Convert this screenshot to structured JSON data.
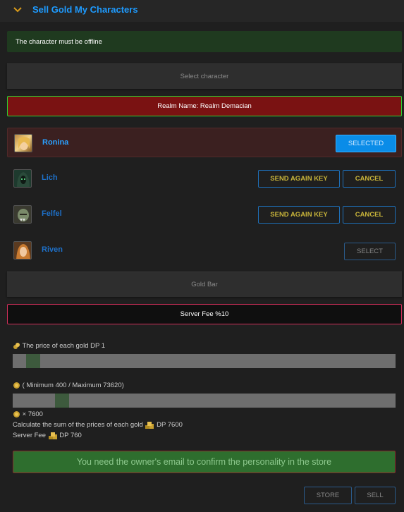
{
  "header": {
    "title": "Sell Gold My Characters"
  },
  "notice": "The character must be offline",
  "select_character_label": "Select character",
  "realm_label": "Realm Name: Realm Demacian",
  "characters": [
    {
      "name": "Ronina",
      "state": "selected",
      "selected_label": "SELECTED"
    },
    {
      "name": "Lich",
      "state": "pending",
      "send_label": "SEND AGAIN KEY",
      "cancel_label": "CANCEL"
    },
    {
      "name": "Felfel",
      "state": "pending",
      "send_label": "SEND AGAIN KEY",
      "cancel_label": "CANCEL"
    },
    {
      "name": "Riven",
      "state": "selectable",
      "select_label": "SELECT"
    }
  ],
  "gold_bar_label": "Gold Bar",
  "server_fee_label": "Server Fee %10",
  "price": {
    "label": "The price of each gold DP 1",
    "slider_fraction": 0.035
  },
  "amount": {
    "label": "( Minimum 400 / Maximum 73620)",
    "slider_fraction": 0.11
  },
  "summary": {
    "multiplier": "× 7600",
    "sum_label": "Calculate the sum of the prices of each gold",
    "sum_value": "DP 7600",
    "fee_label": "Server Fee",
    "fee_value": "DP 760"
  },
  "confirm_message": "You need the owner's email to confirm the personality in the store",
  "actions": {
    "store": "STORE",
    "sell": "SELL"
  },
  "colors": {
    "accent": "#1e9bff",
    "realm_bg": "#7a1212",
    "confirm_bg": "#2e6e2e"
  }
}
